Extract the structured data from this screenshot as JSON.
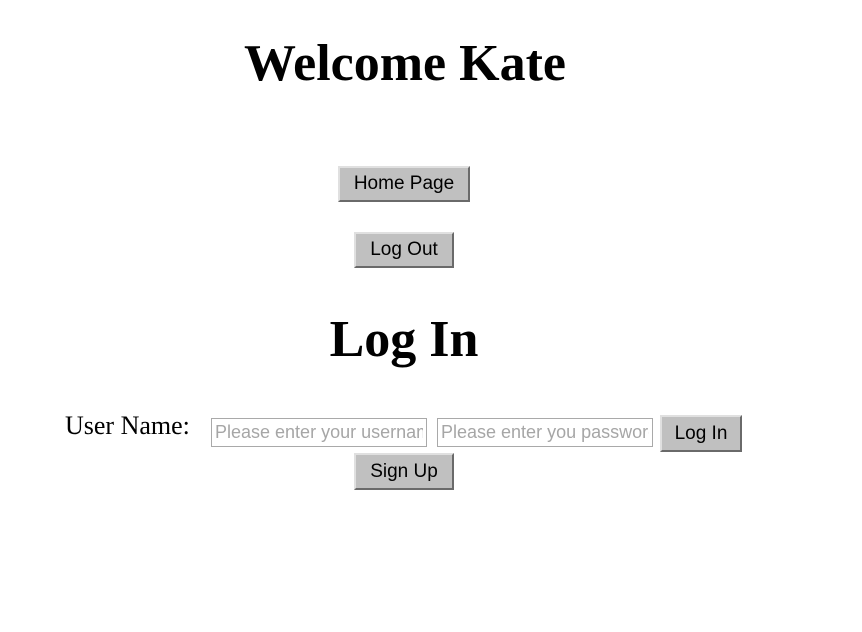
{
  "welcome": {
    "heading": "Welcome Kate",
    "home_label": "Home Page",
    "logout_label": "Log Out"
  },
  "login": {
    "heading": "Log In",
    "username_label": "User Name:",
    "username_value": "",
    "username_placeholder": "Please enter your username",
    "password_value": "",
    "password_placeholder": "Please enter you password",
    "login_label": "Log In",
    "signup_label": "Sign Up"
  },
  "colors": {
    "button_face": "#c0c0c0",
    "input_border": "#a9a9a9",
    "placeholder": "#a6a6a6"
  }
}
